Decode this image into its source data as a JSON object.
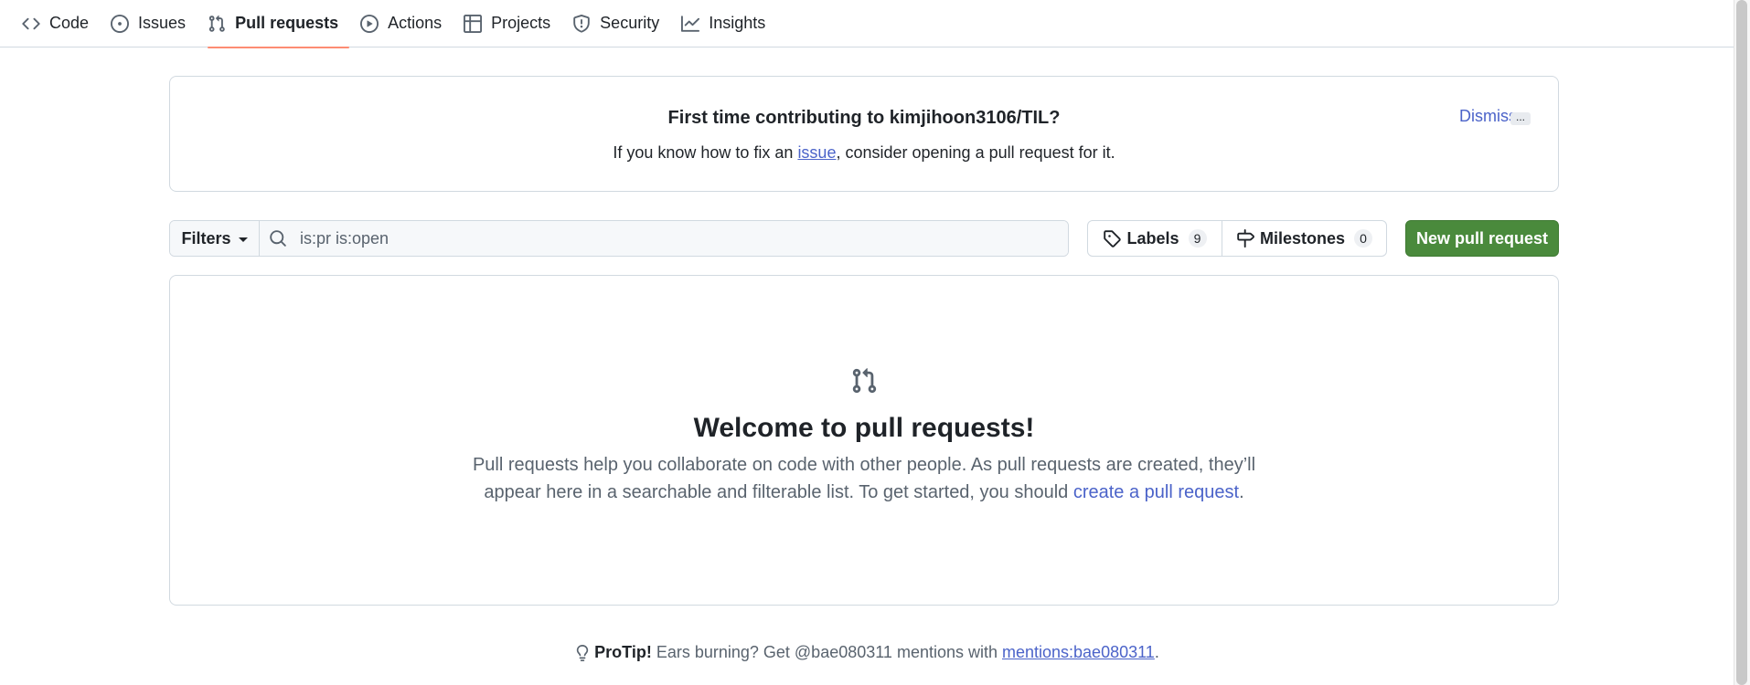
{
  "nav": {
    "items": [
      {
        "label": "Code",
        "icon": "code-icon"
      },
      {
        "label": "Issues",
        "icon": "issue-opened-icon"
      },
      {
        "label": "Pull requests",
        "icon": "git-pull-request-icon",
        "selected": true
      },
      {
        "label": "Actions",
        "icon": "play-icon"
      },
      {
        "label": "Projects",
        "icon": "table-icon"
      },
      {
        "label": "Security",
        "icon": "shield-icon"
      },
      {
        "label": "Insights",
        "icon": "graph-icon"
      }
    ]
  },
  "banner": {
    "title": "First time contributing to kimjihoon3106/TIL?",
    "text_before": "If you know how to fix an ",
    "link": "issue",
    "text_after": ", consider opening a pull request for it.",
    "dismiss": "Dismiss",
    "more": "..."
  },
  "filters": {
    "button": "Filters",
    "search_value": "",
    "search_placeholder": "is:pr is:open"
  },
  "labels": {
    "label": "Labels",
    "count": "9"
  },
  "milestones": {
    "label": "Milestones",
    "count": "0"
  },
  "new_pr": {
    "label": "New pull request"
  },
  "blankslate": {
    "title": "Welcome to pull requests!",
    "text": "Pull requests help you collaborate on code with other people. As pull requests are created, they’ll appear here in a searchable and filterable list. To get started, you should ",
    "link": "create a pull request",
    "suffix": "."
  },
  "protip": {
    "bold": "ProTip!",
    "text": " Ears burning? Get @bae080311 mentions with ",
    "link": "mentions:bae080311",
    "suffix": "."
  },
  "colors": {
    "accent_link": "#4b63c9",
    "primary_button": "#4a8a3c",
    "selected_underline": "#fd8c73"
  }
}
